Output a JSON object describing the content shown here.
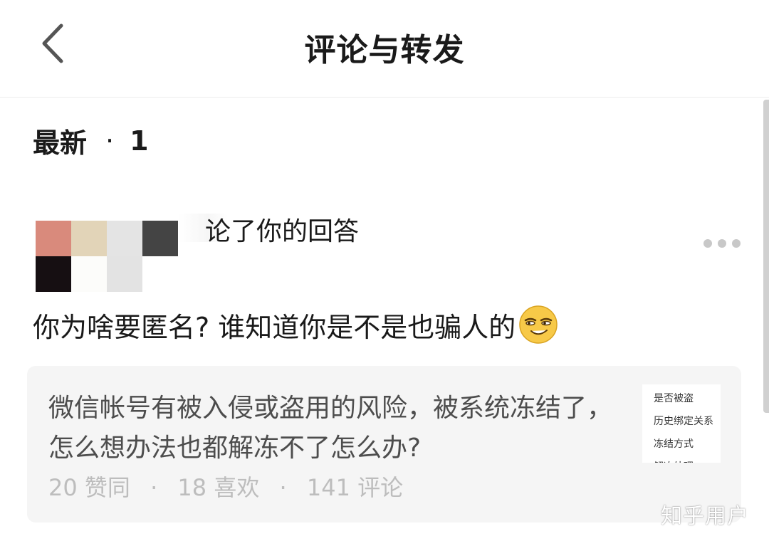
{
  "header": {
    "back_icon": "chevron-left-icon",
    "title": "评论与转发"
  },
  "section": {
    "label": "最新",
    "separator": "·",
    "count": "1"
  },
  "notification": {
    "avatar_icon": "pixelated-avatar",
    "avatar_colors": [
      "#d98a7c",
      "#e2d4b8",
      "#e4e4e4",
      "#444444",
      "#160f12",
      "#fcfcfa",
      "#e3e3e3",
      "#ffffff"
    ],
    "action_text": "论了你的回答",
    "more_icon": "more-dots-icon",
    "comment": "你为啥要匿名? 谁知道你是不是也骗人的",
    "emoji_icon": "smirk-emoji-icon"
  },
  "quoted_answer": {
    "title": "微信帐号有被入侵或盗用的风险，被系统冻结了，怎么想办法也都解冻不了怎么办?",
    "stats": {
      "agree": "20 赞同",
      "likes": "18 喜欢",
      "comments": "141 评论",
      "separator": "·"
    },
    "thumbnail_lines": [
      "是否被盗",
      "历史绑定关系",
      "冻结方式",
      "解冻处理"
    ]
  },
  "watermark": "知乎用户",
  "colors": {
    "card_bg": "#f5f5f5",
    "stats_text": "#bdbdbd",
    "quote_text": "#4d4d4d",
    "primary_text": "#1a1a1a"
  }
}
